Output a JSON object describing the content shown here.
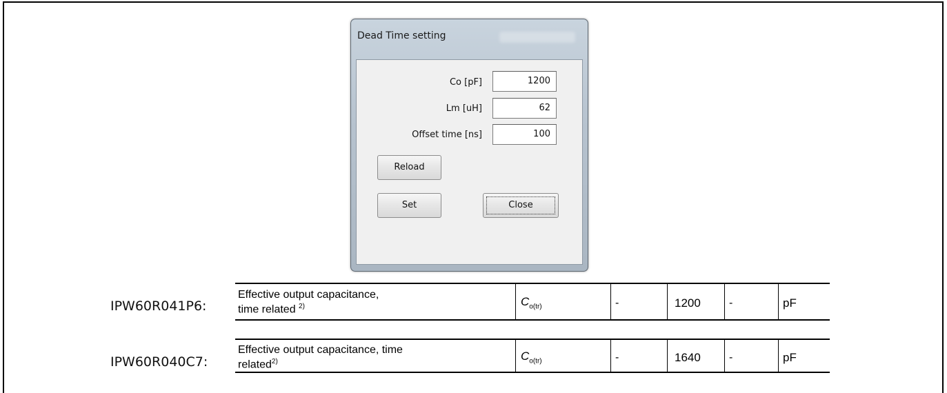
{
  "dialog": {
    "title": "Dead Time setting",
    "fields": [
      {
        "label": "Co [pF]",
        "value": "1200"
      },
      {
        "label": "Lm [uH]",
        "value": "62"
      },
      {
        "label": "Offset time [ns]",
        "value": "100"
      }
    ],
    "buttons": {
      "reload": "Reload",
      "set": "Set",
      "close": "Close"
    }
  },
  "tables": [
    {
      "part": "IPW60R041P6:",
      "desc_line1": "Effective output capacitance,",
      "desc_line2": "time related",
      "footnote": "2)",
      "symbol_main": "C",
      "symbol_sub": "o(tr)",
      "min": "-",
      "typ": "1200",
      "max": "-",
      "unit": "pF"
    },
    {
      "part": "IPW60R040C7:",
      "desc_line1": "Effective output capacitance, time",
      "desc_line2": "related",
      "footnote": "2)",
      "symbol_main": "C",
      "symbol_sub": "o(tr)",
      "min": "-",
      "typ": "1640",
      "max": "-",
      "unit": "pF"
    }
  ]
}
